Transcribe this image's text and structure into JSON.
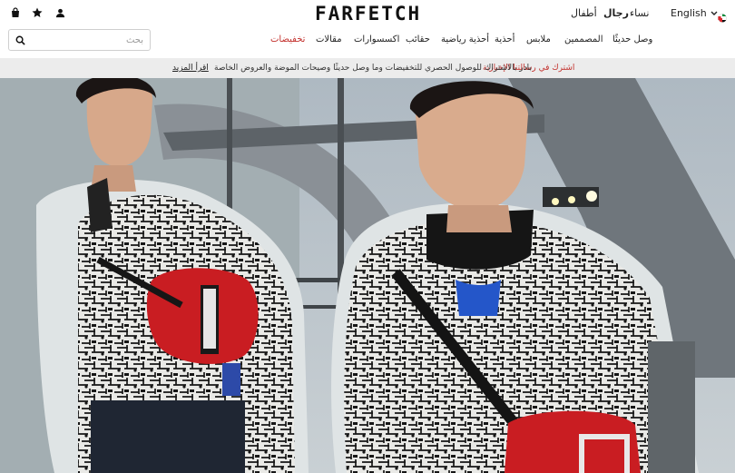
{
  "header": {
    "logo": "FARFETCH",
    "departments": {
      "kids": "أطفال",
      "men": "رجال",
      "women": "نساء"
    },
    "language": "English",
    "icons": [
      "bag-icon",
      "star-icon",
      "user-icon",
      "chevron-down-icon",
      "flag-icon",
      "search-icon"
    ]
  },
  "search": {
    "placeholder": "بحث",
    "value": ""
  },
  "nav": {
    "new_in": "وصل حديثًا",
    "designers": "المصممين",
    "clothing": "ملابس",
    "shoes": "أحذية",
    "sneakers": "أحذية رياضية",
    "bags": "حقائب",
    "accessories": "اكسسوارات",
    "stories": "مقالات",
    "sale": "تخفيضات"
  },
  "promo": {
    "subscribe": "اشترك في رسالتنا الإخبارية",
    "text": "بادر بالاشتراك للوصول الحصري للتخفيضات وما وصل حديثًا وصيحات الموضة والعروض الخاصة",
    "more": "اقرأ المزيد"
  },
  "colors": {
    "sale": "#c3302c",
    "promo_bg": "#ececec",
    "brand": "#111111"
  }
}
